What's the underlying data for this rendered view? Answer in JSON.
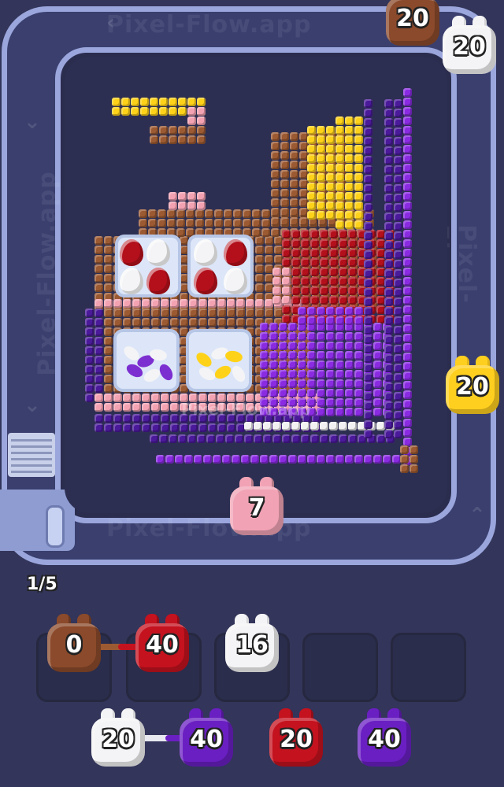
{
  "watermarks": {
    "track_top": "Pixel-Flow.app",
    "track_bottom": "Pixel-Flow.app",
    "track_right": "Pixel-Flow.app",
    "track_left": "Pixel-Flow.app",
    "board": "Pixel-Flow.app"
  },
  "conveyor_pigs": [
    {
      "name": "brown-pig-top",
      "count": "20",
      "color": "#8b4a2b"
    },
    {
      "name": "white-pig-top",
      "count": "20",
      "color": "#f4f4f6"
    },
    {
      "name": "yellow-pig-right",
      "count": "20",
      "color": "#ffcf1f"
    },
    {
      "name": "pink-pig-bottom",
      "count": "7",
      "color": "#f1a3b5"
    }
  ],
  "progress": "1/5",
  "slots": [
    {
      "count": "0",
      "color": "#8b4a2b"
    },
    {
      "count": "40",
      "color": "#c4121f"
    },
    {
      "count": "16",
      "color": "#f4f4f6"
    },
    {
      "count": "",
      "color": ""
    },
    {
      "count": "",
      "color": ""
    }
  ],
  "queue": [
    {
      "count": "20",
      "color": "#f4f4f6"
    },
    {
      "count": "40",
      "color": "#6a1fc2"
    },
    {
      "count": "20",
      "color": "#c4121f"
    },
    {
      "count": "40",
      "color": "#6a1fc2"
    }
  ],
  "colors": {
    "brown": "#9c5a32",
    "pink": "#f3a2b2",
    "yellow": "#ffd21a",
    "red": "#b3101c",
    "purple": "#8a2be2",
    "dark_purple": "#4a1a9a",
    "white": "#f2f2f2"
  }
}
